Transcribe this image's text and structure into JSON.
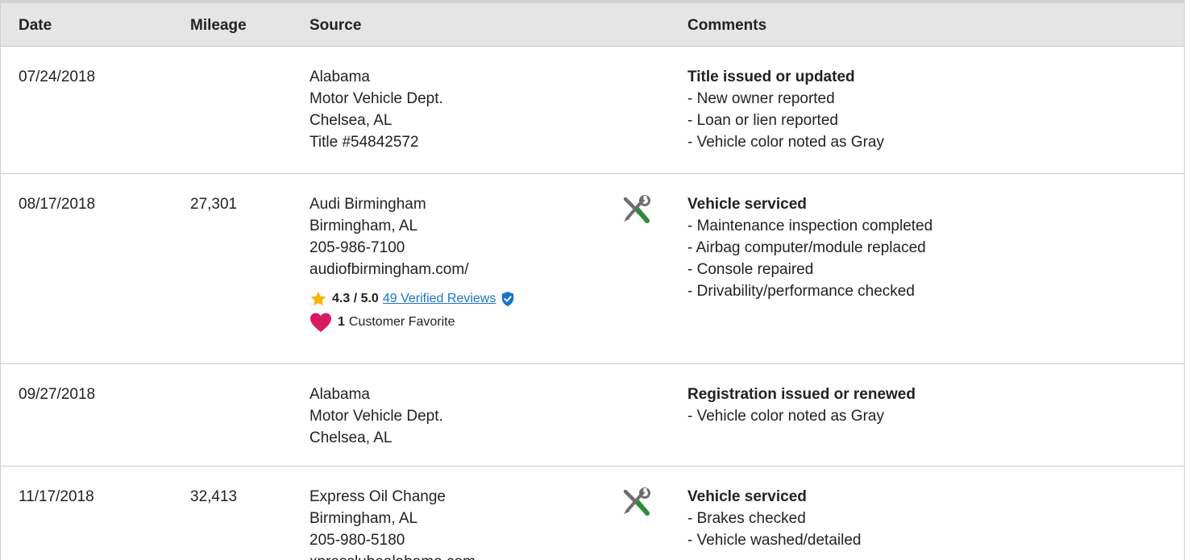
{
  "table": {
    "columns": [
      "Date",
      "Mileage",
      "Source",
      "Comments"
    ],
    "rows": [
      {
        "date": "07/24/2018",
        "mileage": "",
        "source": [
          "Alabama",
          "Motor Vehicle Dept.",
          "Chelsea, AL",
          "Title #54842572"
        ],
        "icon": "",
        "comment_title": "Title issued or updated",
        "comments": [
          "- New owner reported",
          "- Loan or lien reported",
          "- Vehicle color noted as Gray"
        ]
      },
      {
        "date": "08/17/2018",
        "mileage": "27,301",
        "source": [
          "Audi Birmingham",
          "Birmingham, AL",
          "205-986-7100",
          "audiofbirmingham.com/"
        ],
        "icon": "service-tools-icon",
        "rating": {
          "score": "4.3 / 5.0",
          "reviews_link": "49 Verified Reviews",
          "favorite_count": "1",
          "favorite_label": "Customer Favorite"
        },
        "comment_title": "Vehicle serviced",
        "comments": [
          "- Maintenance inspection completed",
          "- Airbag computer/module replaced",
          "- Console repaired",
          "- Drivability/performance checked"
        ]
      },
      {
        "date": "09/27/2018",
        "mileage": "",
        "source": [
          "Alabama",
          "Motor Vehicle Dept.",
          "Chelsea, AL"
        ],
        "icon": "",
        "comment_title": "Registration issued or renewed",
        "comments": [
          "- Vehicle color noted as Gray"
        ]
      },
      {
        "date": "11/17/2018",
        "mileage": "32,413",
        "source": [
          "Express Oil Change",
          "Birmingham, AL",
          "205-980-5180",
          "xpresslubealabama.com"
        ],
        "icon": "service-tools-icon",
        "comment_title": "Vehicle serviced",
        "comments": [
          "- Brakes checked",
          "- Vehicle washed/detailed"
        ]
      }
    ]
  },
  "colors": {
    "header_bg": "#e5e5e5",
    "link": "#1a73c9",
    "star": "#f5b400",
    "heart": "#d81b60",
    "wrench_green": "#2e8b3a",
    "tool_gray": "#6e6e6e",
    "shield": "#1a73c9"
  }
}
